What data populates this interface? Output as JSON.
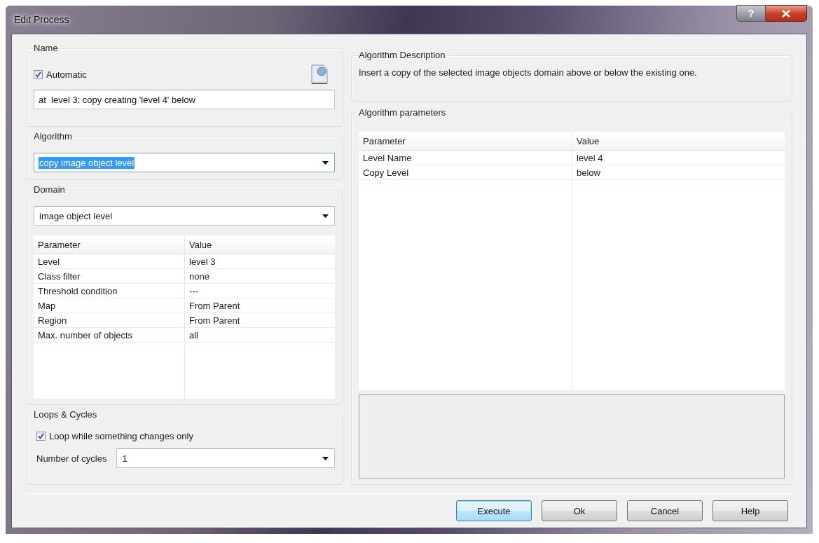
{
  "window": {
    "title": "Edit Process",
    "help_glyph": "?"
  },
  "name": {
    "heading": "Name",
    "automatic": {
      "label": "Automatic",
      "checked": true
    },
    "value": "at  level 3: copy creating 'level 4' below"
  },
  "algorithm": {
    "heading": "Algorithm",
    "value": "copy image object level",
    "highlighted": true
  },
  "domain": {
    "heading": "Domain",
    "value": "image object level",
    "columns": [
      "Parameter",
      "Value"
    ],
    "rows": [
      [
        "Level",
        "level 3"
      ],
      [
        "Class filter",
        "none"
      ],
      [
        "Threshold condition",
        "---"
      ],
      [
        "Map",
        "From Parent"
      ],
      [
        "Region",
        "From Parent"
      ],
      [
        "Max. number of objects",
        "all"
      ]
    ]
  },
  "loops": {
    "heading": "Loops & Cycles",
    "loop_only": {
      "label": "Loop while something changes only",
      "checked": true
    },
    "cycles_label": "Number of cycles",
    "cycles_value": "1"
  },
  "description": {
    "heading": "Algorithm Description",
    "text": "Insert a copy of the selected image objects domain above or below the existing one."
  },
  "parameters": {
    "heading": "Algorithm parameters",
    "columns": [
      "Parameter",
      "Value"
    ],
    "rows": [
      [
        "Level Name",
        "level 4"
      ],
      [
        "Copy Level",
        "below"
      ]
    ]
  },
  "buttons": [
    {
      "label": "Execute",
      "default": true
    },
    {
      "label": "Ok",
      "default": false
    },
    {
      "label": "Cancel",
      "default": false
    },
    {
      "label": "Help",
      "default": false
    }
  ]
}
